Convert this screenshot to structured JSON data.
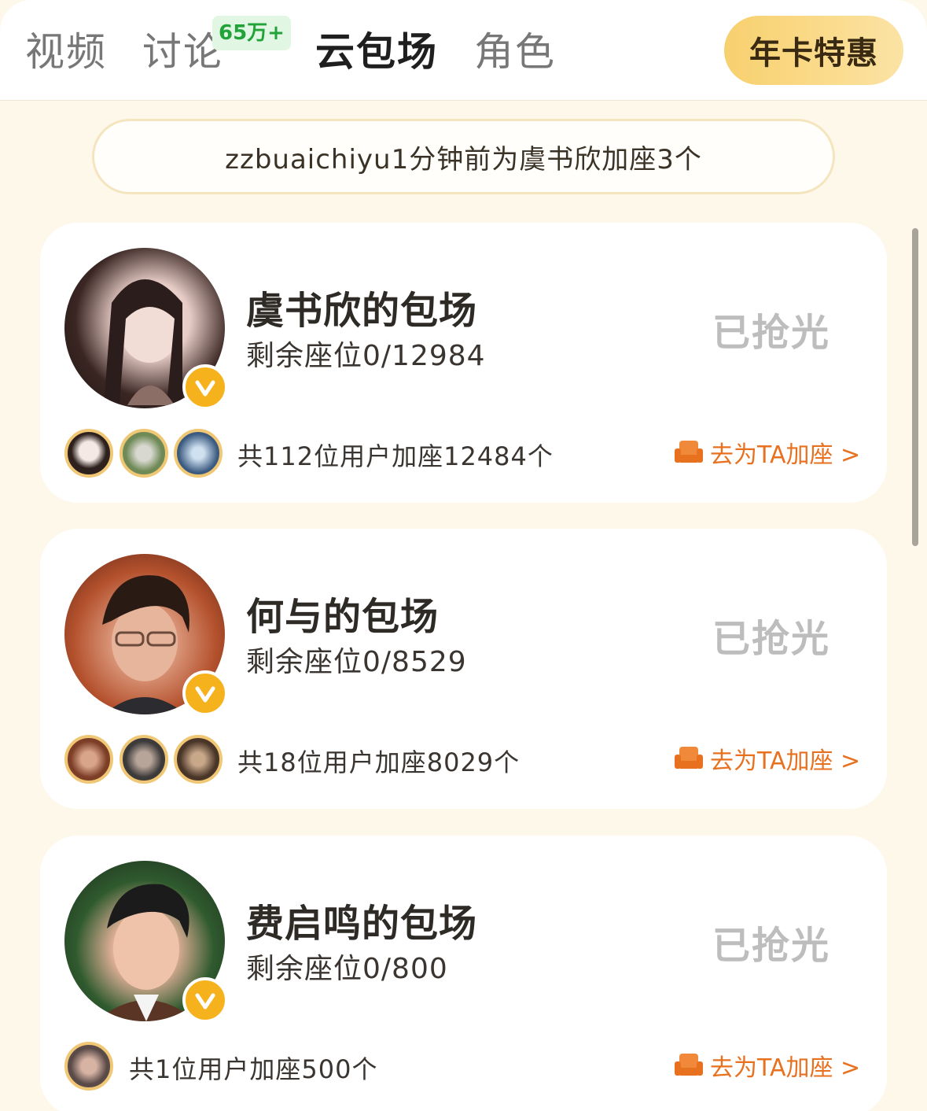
{
  "header": {
    "tabs": [
      {
        "label": "视频",
        "active": false
      },
      {
        "label": "讨论",
        "active": false,
        "badge": "65万+"
      },
      {
        "label": "云包场",
        "active": true
      },
      {
        "label": "角色",
        "active": false
      }
    ],
    "promo_label": "年卡特惠"
  },
  "notice": "zzbuaichiyu1分钟前为虞书欣加座3个",
  "cards": [
    {
      "title": "虞书欣的包场",
      "seats": "剩余座位0/12984",
      "status": "已抢光",
      "summary": "共112位用户加座12484个",
      "action": "去为TA加座 >",
      "avatar_tone": [
        "#e9d4cf",
        "#2b1d1b"
      ],
      "mini_tones": [
        "#efe6e2",
        "#6f8a56",
        "#3b5a80"
      ]
    },
    {
      "title": "何与的包场",
      "seats": "剩余座位0/8529",
      "status": "已抢光",
      "summary": "共18位用户加座8029个",
      "action": "去为TA加座 >",
      "avatar_tone": [
        "#b4512d",
        "#2a1a14"
      ],
      "mini_tones": [
        "#7c3e26",
        "#3c3a3a",
        "#4a3628"
      ]
    },
    {
      "title": "费启鸣的包场",
      "seats": "剩余座位0/800",
      "status": "已抢光",
      "summary": "共1位用户加座500个",
      "action": "去为TA加座 >",
      "avatar_tone": [
        "#2f5a2e",
        "#1c1b1b"
      ],
      "mini_tones": [
        "#5a4a48"
      ]
    }
  ],
  "colors": {
    "page_bg": "#fdf8ea",
    "accent_orange": "#e8711f",
    "badge_green": "#22a33a",
    "sold_out_gray": "#bdbdbd"
  }
}
